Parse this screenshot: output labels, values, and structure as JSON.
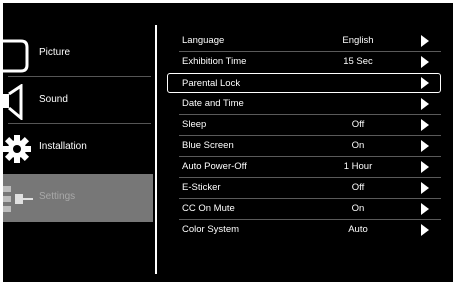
{
  "sidebar": {
    "items": [
      {
        "label": "Picture",
        "icon": "picture-icon"
      },
      {
        "label": "Sound",
        "icon": "speaker-icon"
      },
      {
        "label": "Installation",
        "icon": "gear-icon"
      },
      {
        "label": "Settings",
        "icon": "settings-icon"
      }
    ],
    "selected": "Settings"
  },
  "settings": {
    "rows": [
      {
        "name": "Language",
        "value": "English"
      },
      {
        "name": "Exhibition Time",
        "value": "15 Sec"
      },
      {
        "name": "Parental Lock",
        "value": ""
      },
      {
        "name": "Date and Time",
        "value": ""
      },
      {
        "name": "Sleep",
        "value": "Off"
      },
      {
        "name": "Blue Screen",
        "value": "On"
      },
      {
        "name": "Auto Power-Off",
        "value": "1 Hour"
      },
      {
        "name": "E-Sticker",
        "value": "Off"
      },
      {
        "name": "CC On Mute",
        "value": "On"
      },
      {
        "name": "Color System",
        "value": "Auto"
      }
    ],
    "focused": "Parental Lock"
  },
  "colors": {
    "background": "#000000",
    "text": "#ffffff",
    "selected_bg": "#777777"
  }
}
